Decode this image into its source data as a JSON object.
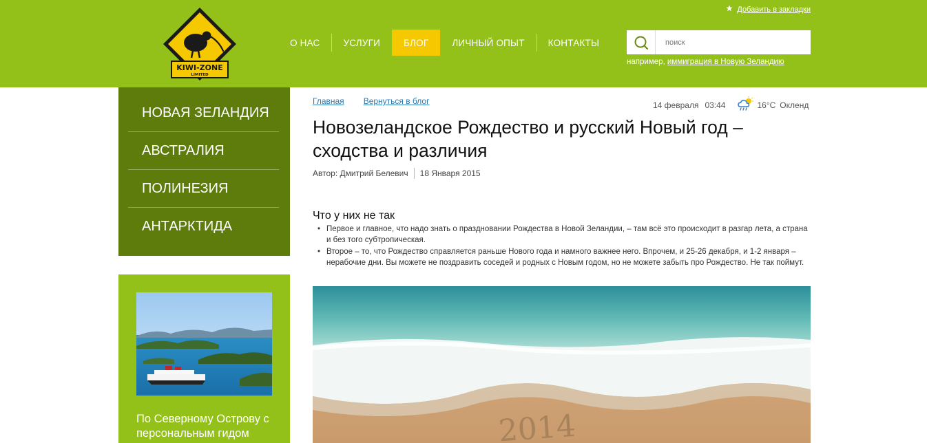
{
  "header": {
    "bookmark_label": "Добавить в закладки",
    "nav": [
      "О НАС",
      "УСЛУГИ",
      "БЛОГ",
      "ЛИЧНЫЙ ОПЫТ",
      "КОНТАКТЫ"
    ],
    "active_nav": "БЛОГ",
    "search": {
      "placeholder": "поиск",
      "hint_prefix": "например, ",
      "hint_link": "иммиграция в Новую Зеландию"
    },
    "logo": {
      "text_main": "KIWI-ZONE",
      "text_sub": "LIMITED"
    }
  },
  "sidebar": {
    "regions": [
      "НОВАЯ ЗЕЛАНДИЯ",
      "АВСТРАЛИЯ",
      "ПОЛИНЕЗИЯ",
      "АНТАРКТИДА"
    ],
    "tour_title": "По Северному Острову с персональным гидом"
  },
  "article": {
    "breadcrumbs": [
      "Главная",
      "Вернуться в блог"
    ],
    "date": "14 февраля",
    "time": "03:44",
    "weather": {
      "temp": "16°C",
      "city": "Окленд",
      "icon": "partly-cloudy-rain-icon"
    },
    "title": "Новозеландское Рождество и русский Новый год – сходства и различия",
    "author": "Автор: Дмитрий Белевич",
    "published": "18 Января 2015",
    "subhead": "Что у них не так",
    "bullets": [
      "Первое и главное, что надо знать о праздновании Рождества в Новой Зеландии, – там всё это происходит в разгар лета, а страна и без того субтропическая.",
      "Второе – то, что Рождество справляется раньше Нового года и намного важнее него. Впрочем, и 25-26 декабря, и 1-2 января – нерабочие дни. Вы можете не поздравить соседей и родных с Новым годом, но не можете забыть про Рождество. Не так поймут."
    ],
    "image_sand_text": "2014"
  },
  "colors": {
    "header_green": "#93c11a",
    "menu_dark_green": "#5e7c0c",
    "active_yellow": "#f5c800",
    "link_blue": "#2e7bb0"
  }
}
